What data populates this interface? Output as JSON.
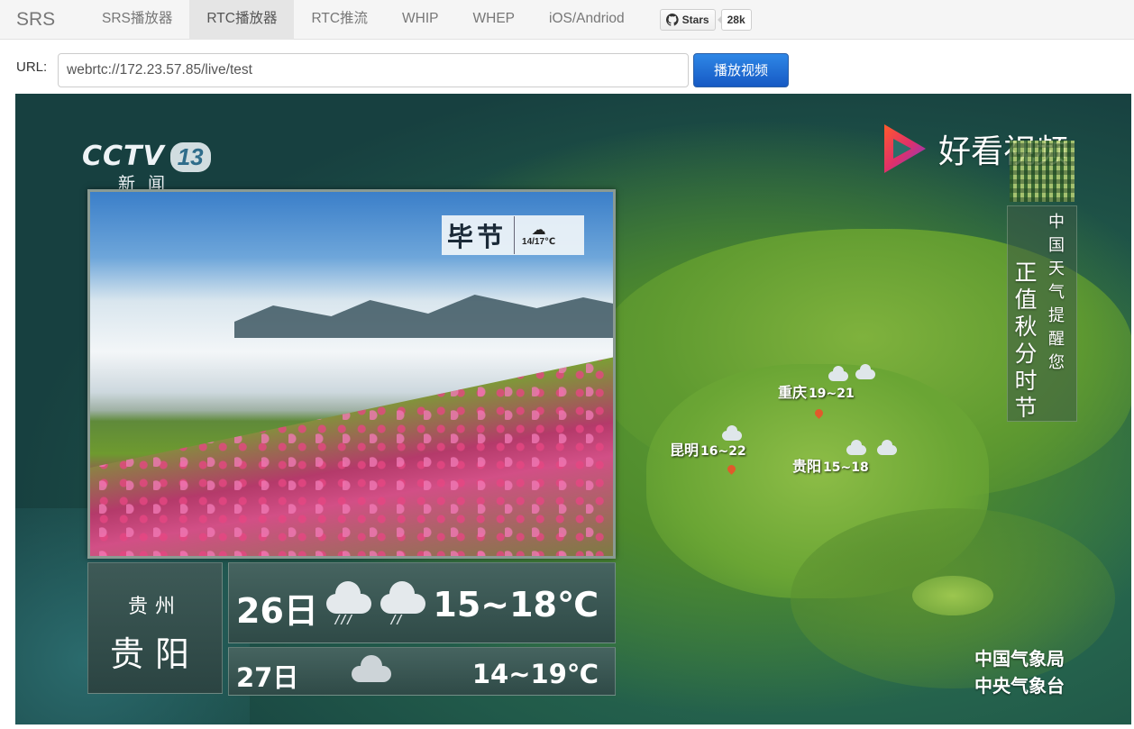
{
  "navbar": {
    "brand": "SRS",
    "items": [
      {
        "label": "SRS播放器"
      },
      {
        "label": "RTC播放器"
      },
      {
        "label": "RTC推流"
      },
      {
        "label": "WHIP"
      },
      {
        "label": "WHEP"
      },
      {
        "label": "iOS/Andriod"
      }
    ],
    "active_index": 1,
    "github": {
      "button_label": "Stars",
      "count": "28k",
      "icon": "github-icon"
    }
  },
  "url_bar": {
    "label": "URL:",
    "value": "webrtc://172.23.57.85/live/test",
    "button_label": "播放视频"
  },
  "video": {
    "channel": {
      "logo": "CCTV",
      "number": "13",
      "subtitle": "新闻"
    },
    "watermark": {
      "text": "好看视频",
      "icon": "haokan-play-logo"
    },
    "banner": {
      "small": "中国天气提醒您",
      "big": "正值秋分时节"
    },
    "map_cities": [
      {
        "name": "重庆",
        "temp": "19~21"
      },
      {
        "name": "昆明",
        "temp": "16~22"
      },
      {
        "name": "贵阳",
        "temp": "15~18"
      }
    ],
    "photo_card": {
      "location": "毕节",
      "temp": "14/17℃",
      "icon": "rain-cloud-icon"
    },
    "forecast": {
      "province": "贵州",
      "city": "贵阳",
      "days": [
        {
          "day": "26日",
          "temp": "15~18℃",
          "icon": "rain-icon"
        },
        {
          "day": "27日",
          "temp": "14~19℃",
          "icon": "cloudy-icon"
        }
      ]
    },
    "agency": {
      "line1": "中国气象局",
      "line2": "中央气象台"
    }
  },
  "colors": {
    "primary_button": "#1659c4",
    "navbar_bg": "#f5f5f5",
    "active_tab_bg": "#e5e5e5"
  }
}
